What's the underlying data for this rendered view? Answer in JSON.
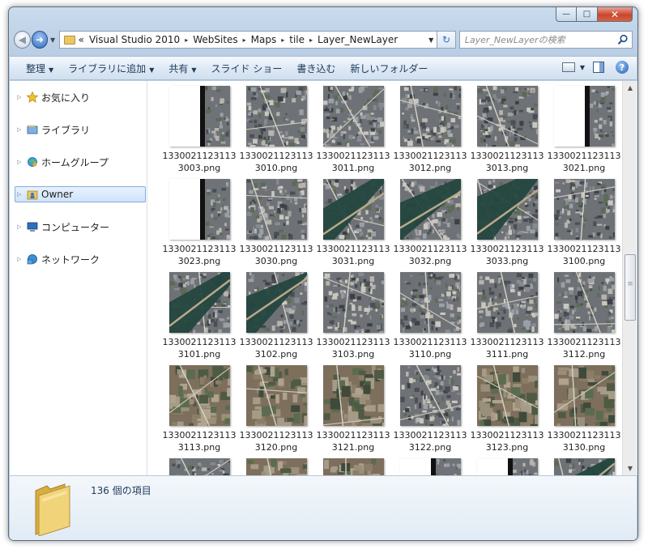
{
  "window": {
    "caption_buttons": {
      "minimize": "—",
      "maximize": "□",
      "close": "✕"
    }
  },
  "nav": {
    "back_glyph": "◀",
    "forward_glyph": "➜",
    "history_dropdown": "▼",
    "breadcrumb_prefix": "«",
    "breadcrumbs": [
      "Visual Studio 2010",
      "WebSites",
      "Maps",
      "tile",
      "Layer_NewLayer"
    ],
    "breadcrumb_separator": "▸",
    "address_dropdown": "▼",
    "refresh_glyph": "↻",
    "search_placeholder": "Layer_NewLayerの検索"
  },
  "toolbar": {
    "items": [
      {
        "label": "整理",
        "has_dropdown": true
      },
      {
        "label": "ライブラリに追加",
        "has_dropdown": true
      },
      {
        "label": "共有",
        "has_dropdown": true
      },
      {
        "label": "スライド ショー",
        "has_dropdown": false
      },
      {
        "label": "書き込む",
        "has_dropdown": false
      },
      {
        "label": "新しいフォルダー",
        "has_dropdown": false
      }
    ],
    "dropdown_glyph": "▼",
    "help_glyph": "?"
  },
  "sidebar": {
    "expander_glyph": "▷",
    "items": [
      {
        "label": "お気に入り",
        "icon": "star-icon",
        "selected": false
      },
      {
        "label": "ライブラリ",
        "icon": "library-icon",
        "selected": false
      },
      {
        "label": "ホームグループ",
        "icon": "homegroup-icon",
        "selected": false
      },
      {
        "label": "Owner",
        "icon": "user-folder-icon",
        "selected": true
      },
      {
        "label": "コンピューター",
        "icon": "computer-icon",
        "selected": false
      },
      {
        "label": "ネットワーク",
        "icon": "network-icon",
        "selected": false
      }
    ]
  },
  "files": [
    {
      "name": "13300211231133003.png",
      "thumb": "edge"
    },
    {
      "name": "13300211231133010.png",
      "thumb": "city"
    },
    {
      "name": "13300211231133011.png",
      "thumb": "city"
    },
    {
      "name": "13300211231133012.png",
      "thumb": "city"
    },
    {
      "name": "13300211231133013.png",
      "thumb": "city"
    },
    {
      "name": "13300211231133021.png",
      "thumb": "edge"
    },
    {
      "name": "13300211231133023.png",
      "thumb": "edge"
    },
    {
      "name": "13300211231133030.png",
      "thumb": "city"
    },
    {
      "name": "13300211231133031.png",
      "thumb": "river"
    },
    {
      "name": "13300211231133032.png",
      "thumb": "river"
    },
    {
      "name": "13300211231133033.png",
      "thumb": "river"
    },
    {
      "name": "13300211231133100.png",
      "thumb": "city"
    },
    {
      "name": "13300211231133101.png",
      "thumb": "river"
    },
    {
      "name": "13300211231133102.png",
      "thumb": "river"
    },
    {
      "name": "13300211231133103.png",
      "thumb": "city"
    },
    {
      "name": "13300211231133110.png",
      "thumb": "city"
    },
    {
      "name": "13300211231133111.png",
      "thumb": "city"
    },
    {
      "name": "13300211231133112.png",
      "thumb": "city"
    },
    {
      "name": "13300211231133113.png",
      "thumb": "fields"
    },
    {
      "name": "13300211231133120.png",
      "thumb": "fields"
    },
    {
      "name": "13300211231133121.png",
      "thumb": "fields"
    },
    {
      "name": "13300211231133122.png",
      "thumb": "city"
    },
    {
      "name": "13300211231133123.png",
      "thumb": "fields"
    },
    {
      "name": "13300211231133130.png",
      "thumb": "fields"
    },
    {
      "name": "",
      "thumb": "city"
    },
    {
      "name": "",
      "thumb": "fields"
    },
    {
      "name": "",
      "thumb": "fields"
    },
    {
      "name": "",
      "thumb": "edge"
    },
    {
      "name": "",
      "thumb": "edge"
    },
    {
      "name": "",
      "thumb": "river"
    }
  ],
  "status": {
    "item_count": "136 個の項目"
  },
  "scrollbar": {
    "up_glyph": "▲",
    "down_glyph": "▼",
    "grip_glyph": "≡"
  },
  "colors": {
    "frame": "#b9cde3",
    "toolbar_text": "#1e395b",
    "selection": "#cfe3fb",
    "folder": "#e9c764"
  }
}
